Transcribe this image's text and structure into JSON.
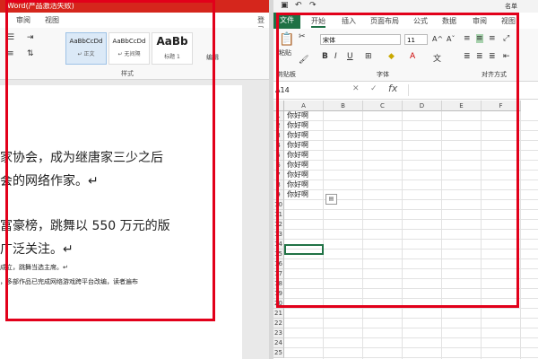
{
  "word": {
    "title": "Word(产品激活失败)",
    "tabs": [
      "审阅",
      "视图"
    ],
    "styles": [
      {
        "sample": "AaBbCcDd",
        "name": "↵ 正文"
      },
      {
        "sample": "AaBbCcDd",
        "name": "↵ 无间隔"
      },
      {
        "sample": "AaBb",
        "name": "标题 1"
      }
    ],
    "styles_group": "样式",
    "edit_label": "编辑",
    "doc_lines": [
      "家协会，成为继唐家三少之后",
      "会的网络作家。↵",
      "富豪榜，跳舞以 550 万元的版",
      "广泛关注。↵",
      "成立，跳舞当选主席。↵",
      "，多部作品已完成网络游戏跨平台改编，读者遍布"
    ],
    "login_label": "登录"
  },
  "excel": {
    "title_right": "名单",
    "file_tab": "文件",
    "tabs": [
      "开始",
      "插入",
      "页面布局",
      "公式",
      "数据",
      "审阅",
      "视图"
    ],
    "paste_label": "粘贴",
    "clipboard_label": "剪贴板",
    "font_name": "宋体",
    "font_size": "11",
    "font_group": "字体",
    "align_group": "对齐方式",
    "name_box": "A14",
    "fx": "fx",
    "columns": [
      "A",
      "B",
      "C",
      "D",
      "E",
      "F"
    ],
    "rows": [
      "1",
      "2",
      "3",
      "4",
      "5",
      "6",
      "7",
      "8",
      "9",
      "10",
      "11",
      "12",
      "13",
      "14",
      "15",
      "16",
      "17",
      "18",
      "19",
      "20",
      "21",
      "22",
      "23",
      "24",
      "25"
    ],
    "cells_a": [
      "你好啊",
      "你好啊",
      "你好啊",
      "你好啊",
      "你好啊",
      "你好啊",
      "你好啊",
      "你好啊",
      "你好啊"
    ]
  },
  "colors": {
    "highlight": "#e2001a",
    "excel_green": "#1e7145",
    "word_red": "#d5261c"
  }
}
